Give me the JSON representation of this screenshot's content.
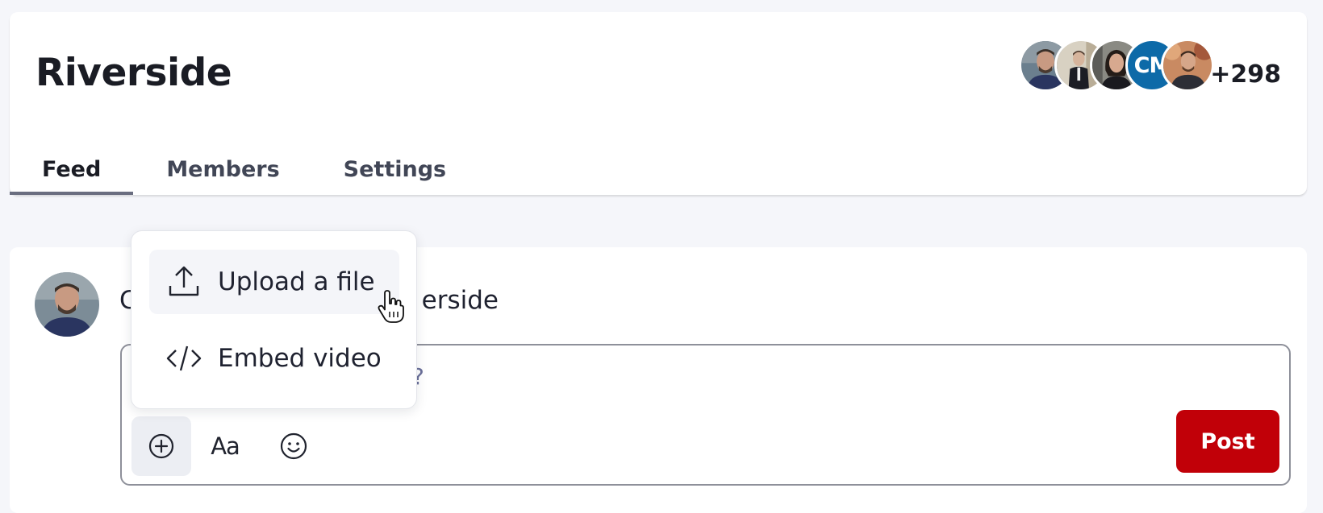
{
  "space": {
    "title": "Riverside",
    "member_avatars": [
      {
        "kind": "photo",
        "name": "man-blue-shirt",
        "bg": "#6b7f8e"
      },
      {
        "kind": "photo",
        "name": "man-suit-hallway",
        "bg": "#c9c2b3"
      },
      {
        "kind": "photo",
        "name": "woman-dark-hair",
        "bg": "#7d7d78"
      },
      {
        "kind": "initials",
        "initials": "CM",
        "bg": "#0d6aa8"
      },
      {
        "kind": "photo",
        "name": "man-autumn",
        "bg": "#b07456"
      }
    ],
    "extra_members": "+298"
  },
  "tabs": [
    {
      "label": "Feed",
      "active": true
    },
    {
      "label": "Members",
      "active": false
    },
    {
      "label": "Settings",
      "active": false
    }
  ],
  "composer": {
    "prompt_visible_start": "C",
    "prompt_visible_end": "erside",
    "placeholder_visible_tail": "?",
    "post_label": "Post",
    "format_glyph": "Aa",
    "icons": [
      "plus-circle-icon",
      "text-format-icon",
      "smiley-icon"
    ]
  },
  "attach_menu": {
    "items": [
      {
        "label": "Upload a file",
        "icon": "upload-icon"
      },
      {
        "label": "Embed video",
        "icon": "code-icon"
      }
    ]
  },
  "colors": {
    "accent_post": "#c10008",
    "page_bg": "#f5f6fa",
    "avatar_cm": "#0d6aa8"
  }
}
